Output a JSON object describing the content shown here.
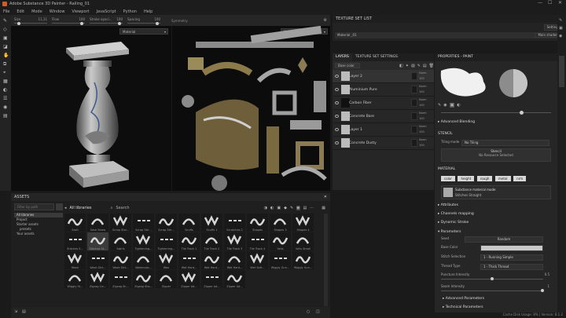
{
  "window": {
    "title": "Adobe Substance 3D Painter - Railing_01",
    "controls": [
      "—",
      "☐",
      "✕"
    ]
  },
  "menu": [
    "File",
    "Edit",
    "Mode",
    "Window",
    "Viewport",
    "JavaScript",
    "Python",
    "Help"
  ],
  "toolbar": {
    "size_label": "Size",
    "size_value": "11,11",
    "flow_label": "Flow",
    "flow_value": "100",
    "stroke_opacity_label": "Stroke opaci...",
    "stroke_opacity_value": "100",
    "spacing_label": "Spacing",
    "spacing_value": "100",
    "symmetry_label": "Symmetry"
  },
  "viewport": {
    "left_mode": "Material",
    "right_mode": "Material"
  },
  "assets": {
    "title": "ASSETS",
    "search_placeholder": "Search",
    "filter_placeholder": "Filter by path",
    "breadcrumb": "All libraries",
    "tree": [
      "All libraries",
      "Project",
      "Starter assets",
      "presets",
      "Your assets"
    ],
    "tiles": [
      [
        "Sash",
        "Sash Straw",
        "Scrap Stai...",
        "Scrap Stri...",
        "Scrap Stri...",
        "Scuffs",
        "Scuffs 1",
        "Scratches 2",
        "Shapes",
        "Shapes 3",
        "Shapes 4"
      ],
      [
        "Stitches S...",
        "Stitches St...",
        "Swirls",
        "Tightening...",
        "Tightening...",
        "Tile Track 1",
        "Tile Track 2",
        "Tile Track 3",
        "Tile Track 4",
        "Veils",
        "Veils Small"
      ],
      [
        "Wash",
        "Wash Dirt...",
        "Wash Dirt...",
        "Watercolo...",
        "Wax",
        "Wet Hard...",
        "Wet Hard...",
        "Wet Hard...",
        "Wet Soft...",
        "Wiggly Gun...",
        "Wiggly Gun..."
      ],
      [
        "Wiggly St...",
        "Zigzag Lin...",
        "Zigzag Sh...",
        "Zigzag Sha...",
        "Zipper",
        "Zipper Ad...",
        "Zipper Ad...",
        "Zipper Ad...",
        "",
        "",
        ""
      ]
    ]
  },
  "texture_set_list": {
    "title": "TEXTURE SET LIST",
    "settings": "Settings",
    "shader": "Main shader",
    "material": "Material _01"
  },
  "layers": {
    "tabs": [
      "LAYERS",
      "TEXTURE SET SETTINGS"
    ],
    "channel": "Base color",
    "rows": [
      {
        "name": "Layer 2",
        "blend": "Norm",
        "opacity": "100",
        "selected": true
      },
      {
        "name": "Aluminium Pure",
        "blend": "Norm",
        "opacity": "100",
        "selected": false
      },
      {
        "name": "Carbon Fiber",
        "blend": "Norm",
        "opacity": "100",
        "selected": false
      },
      {
        "name": "Concrete Bare",
        "blend": "Norm",
        "opacity": "100",
        "selected": false
      },
      {
        "name": "Layer 1",
        "blend": "Norm",
        "opacity": "100",
        "selected": false
      },
      {
        "name": "Concrete Dusty",
        "blend": "Norm",
        "opacity": "100",
        "selected": false
      }
    ]
  },
  "properties": {
    "title": "PROPERTIES - PAINT",
    "advanced_blending": "Advanced Blending",
    "stencil": "STENCIL",
    "tiling_mode_label": "Tiling mode",
    "tiling_mode_value": "No Tiling",
    "stencil_label": "Stencil",
    "stencil_value": "No Resource Selected",
    "material": "MATERIAL",
    "channels": [
      "color",
      "height",
      "rough",
      "metal",
      "nrm"
    ],
    "material_mode": "Substance material mode",
    "material_mode_value": "Stitches Straight",
    "attributes": "Attributes",
    "channels_mapping": "Channels mapping",
    "dynamic_stroke": "Dynamic Stroke",
    "parameters": "Parameters",
    "seed_label": "Seed",
    "seed_value": "Random",
    "base_color_label": "Base Color",
    "stitch_selection_label": "Stitch Selection",
    "stitch_selection_value": "1 - Running Simple",
    "thread_type_label": "Thread Type",
    "thread_type_value": "1 - Thick Thread",
    "puncture_label": "Puncture Intensity",
    "puncture_value": "0.5",
    "seam_label": "Seam Intensity",
    "seam_value": "1",
    "advanced_parameters": "Advanced Parameters",
    "technical_parameters": "Technical Parameters",
    "colors": {
      "accent": "#d85a1e",
      "panel": "#262626",
      "selection": "#333333"
    }
  },
  "status": {
    "text": "Cache Disk Usage: 8% | Version: 8.1.2"
  }
}
